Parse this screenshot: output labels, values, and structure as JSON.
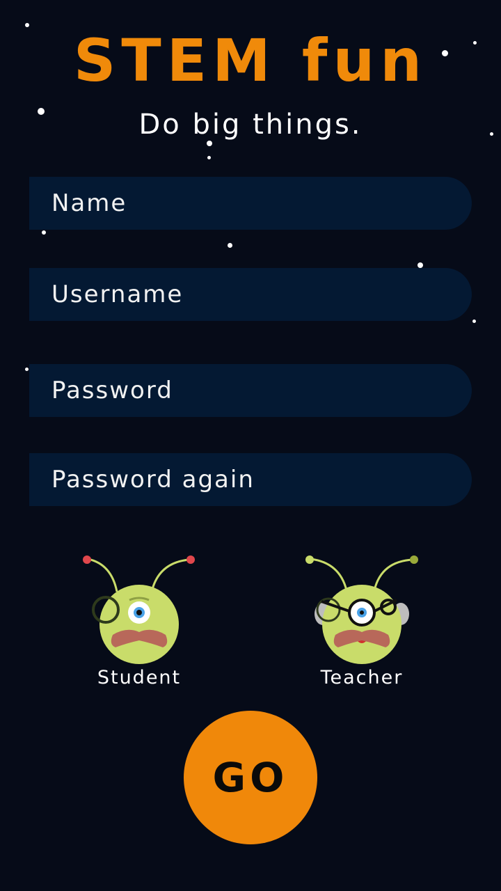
{
  "app": {
    "title": "STEM fun",
    "tagline": "Do big things."
  },
  "form": {
    "name_placeholder": "Name",
    "username_placeholder": "Username",
    "password_placeholder": "Password",
    "password_again_placeholder": "Password again"
  },
  "roles": {
    "student_label": "Student",
    "teacher_label": "Teacher"
  },
  "actions": {
    "go_label": "GO"
  },
  "colors": {
    "background": "#060b18",
    "accent": "#f08a0a",
    "field": "#041933",
    "alien_body": "#c9dc6a"
  }
}
